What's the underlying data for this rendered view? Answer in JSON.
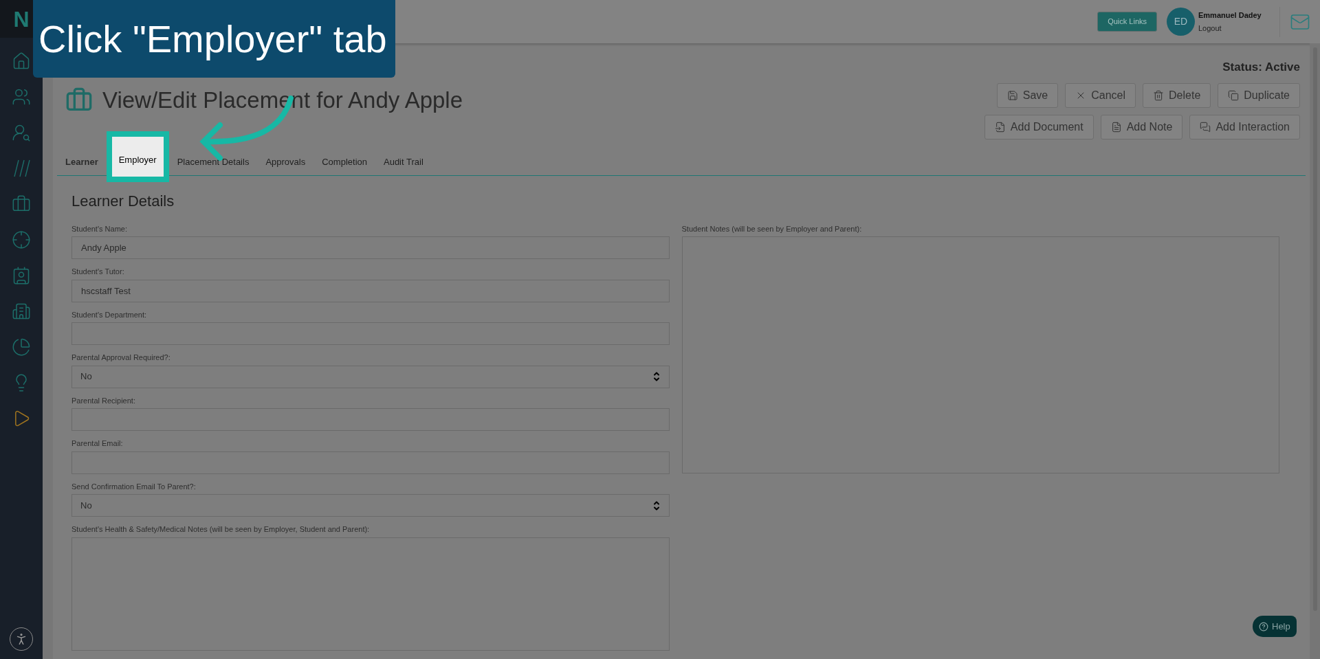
{
  "callout": {
    "text": "Click \"Employer\" tab"
  },
  "sidebar": {
    "logo": "N"
  },
  "header": {
    "quick_links": "Quick Links",
    "user": {
      "initials": "ED",
      "name": "Emmanuel Dadey",
      "logout": "Logout"
    }
  },
  "page": {
    "title": "View/Edit Placement for Andy Apple",
    "status": "Status: Active",
    "actions": [
      [
        "Save",
        "Cancel",
        "Delete",
        "Duplicate"
      ],
      [
        "Add Document",
        "Add Note",
        "Add Interaction"
      ]
    ]
  },
  "tabs": [
    {
      "label": "Learner",
      "selected": true,
      "highlighted": false
    },
    {
      "label": "Employer",
      "selected": false,
      "highlighted": true
    },
    {
      "label": "Placement Details",
      "selected": false,
      "highlighted": false
    },
    {
      "label": "Approvals",
      "selected": false,
      "highlighted": false
    },
    {
      "label": "Completion",
      "selected": false,
      "highlighted": false
    },
    {
      "label": "Audit Trail",
      "selected": false,
      "highlighted": false
    }
  ],
  "section": {
    "title": "Learner Details",
    "fields": [
      {
        "label": "Student's Name:",
        "kind": "text",
        "value": "Andy Apple"
      },
      {
        "label": "Student's Tutor:",
        "kind": "text",
        "value": "hscstaff Test"
      },
      {
        "label": "Student's Department:",
        "kind": "text"
      },
      {
        "label": "Parental Approval Required?:",
        "kind": "select",
        "value": "No"
      },
      {
        "label": "Parental Recipient:",
        "kind": "text"
      },
      {
        "label": "Parental Email:",
        "kind": "text"
      },
      {
        "label": "Send Confirmation Email To Parent?:",
        "kind": "select",
        "value": "No"
      },
      {
        "label": "Student's Health & Safety/Medical Notes (will be seen by Employer, Student and Parent):",
        "kind": "textarea"
      }
    ],
    "notes": {
      "label": "Student Notes (will be seen by Employer and Parent):",
      "kind": "textarea"
    }
  },
  "help": "Help"
}
